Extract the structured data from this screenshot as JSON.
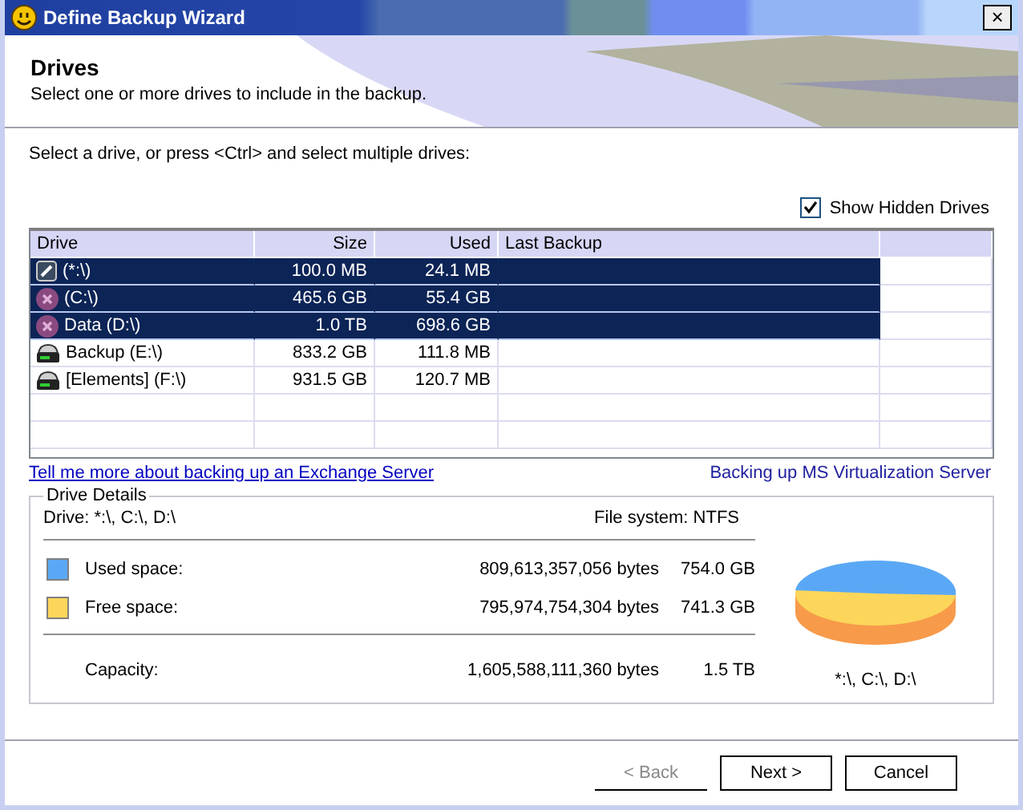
{
  "window": {
    "title": "Define Backup Wizard",
    "close": "×"
  },
  "header": {
    "title": "Drives",
    "subtitle": "Select one or more drives to include in the backup."
  },
  "instruction": "Select a drive, or press <Ctrl> and select multiple drives:",
  "show_hidden": {
    "label": "Show Hidden Drives",
    "checked": true
  },
  "table": {
    "columns": [
      "Drive",
      "Size",
      "Used",
      "Last Backup"
    ],
    "rows": [
      {
        "kind": "system",
        "drive": "(*:\\)",
        "size": "100.0 MB",
        "used": "24.1 MB",
        "selected": true
      },
      {
        "kind": "error",
        "drive": "(C:\\)",
        "size": "465.6 GB",
        "used": "55.4 GB",
        "selected": true
      },
      {
        "kind": "error",
        "drive": "Data (D:\\)",
        "size": "1.0 TB",
        "used": "698.6 GB",
        "selected": true
      },
      {
        "kind": "disk",
        "drive": "Backup (E:\\)",
        "size": "833.2 GB",
        "used": "111.8 MB",
        "selected": false
      },
      {
        "kind": "disk",
        "drive": "[Elements] (F:\\)",
        "size": "931.5 GB",
        "used": "120.7 MB",
        "selected": false
      }
    ]
  },
  "links": [
    "Tell me more about backing up an Exchange Server",
    "Backing up MS Virtualization Server"
  ],
  "drive_details": {
    "title": "Drive Details",
    "drive": "Drive: *:\\, C:\\, D:\\",
    "file_system": "File system: NTFS",
    "spaces": [
      {
        "label": "Used space:",
        "bytes": "809,613,357,056 bytes",
        "size": "754.0 GB",
        "color": "#5aa8f5"
      },
      {
        "label": "Free space:",
        "bytes": "795,974,754,304 bytes",
        "size": "741.3 GB",
        "color": "#fbd65a"
      }
    ],
    "capacity": {
      "label": "Capacity:",
      "bytes": "1,605,588,111,360 bytes",
      "size": "1.5 TB"
    },
    "pie_caption": "*:\\, C:\\, D:\\"
  },
  "buttons": [
    {
      "label": "< Back",
      "disabled": true
    },
    {
      "label": "Next >",
      "disabled": false
    },
    {
      "label": "Cancel",
      "disabled": false
    }
  ]
}
